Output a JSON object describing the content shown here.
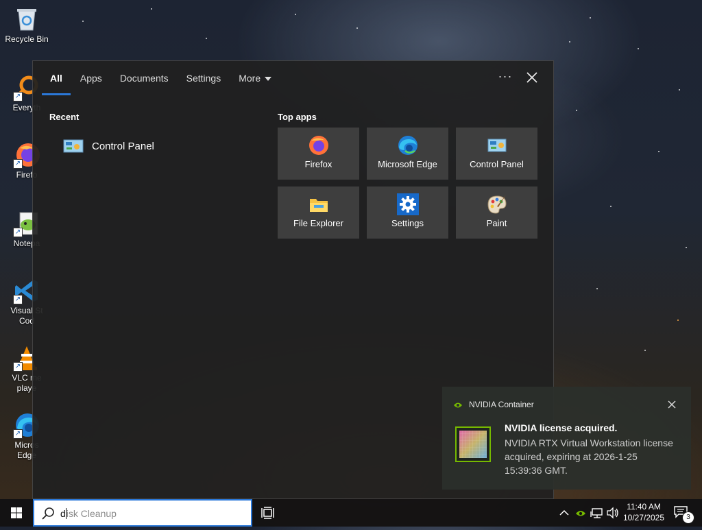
{
  "desktop": {
    "icons": [
      {
        "label": "Recycle Bin",
        "icon": "recycle-bin-icon"
      },
      {
        "label": "Everyth",
        "icon": "everything-search-icon"
      },
      {
        "label": "Firefo",
        "icon": "firefox-icon"
      },
      {
        "label": "Notepa",
        "icon": "notepad-plus-plus-icon"
      },
      {
        "label": "Visual St",
        "label2": "Cod",
        "icon": "vscode-icon"
      },
      {
        "label": "VLC me",
        "label2": "playe",
        "icon": "vlc-icon"
      },
      {
        "label": "Micros",
        "label2": "Edge",
        "icon": "edge-icon"
      }
    ]
  },
  "search_flyout": {
    "tabs": [
      {
        "label": "All",
        "active": true
      },
      {
        "label": "Apps",
        "active": false
      },
      {
        "label": "Documents",
        "active": false
      },
      {
        "label": "Settings",
        "active": false
      },
      {
        "label": "More",
        "active": false,
        "has_dropdown": true
      }
    ],
    "more_options_label": "···",
    "recent": {
      "title": "Recent",
      "items": [
        {
          "label": "Control Panel",
          "icon": "control-panel-icon"
        }
      ]
    },
    "top_apps": {
      "title": "Top apps",
      "items": [
        {
          "label": "Firefox",
          "icon": "firefox-icon"
        },
        {
          "label": "Microsoft Edge",
          "icon": "edge-icon"
        },
        {
          "label": "Control Panel",
          "icon": "control-panel-icon"
        },
        {
          "label": "File Explorer",
          "icon": "file-explorer-icon"
        },
        {
          "label": "Settings",
          "icon": "settings-gear-icon"
        },
        {
          "label": "Paint",
          "icon": "paint-icon"
        }
      ]
    }
  },
  "notification": {
    "app_name": "NVIDIA Container",
    "title": "NVIDIA license acquired.",
    "body": "NVIDIA RTX Virtual Workstation license acquired, expiring at 2026-1-25 15:39:36 GMT."
  },
  "taskbar": {
    "search": {
      "typed": "d",
      "rest": "isk Cleanup"
    },
    "clock": {
      "time": "11:40 AM",
      "date": "10/27/2025"
    },
    "notification_count": "3"
  },
  "colors": {
    "accent": "#2b78d8",
    "nvidia_green": "#76b900"
  }
}
